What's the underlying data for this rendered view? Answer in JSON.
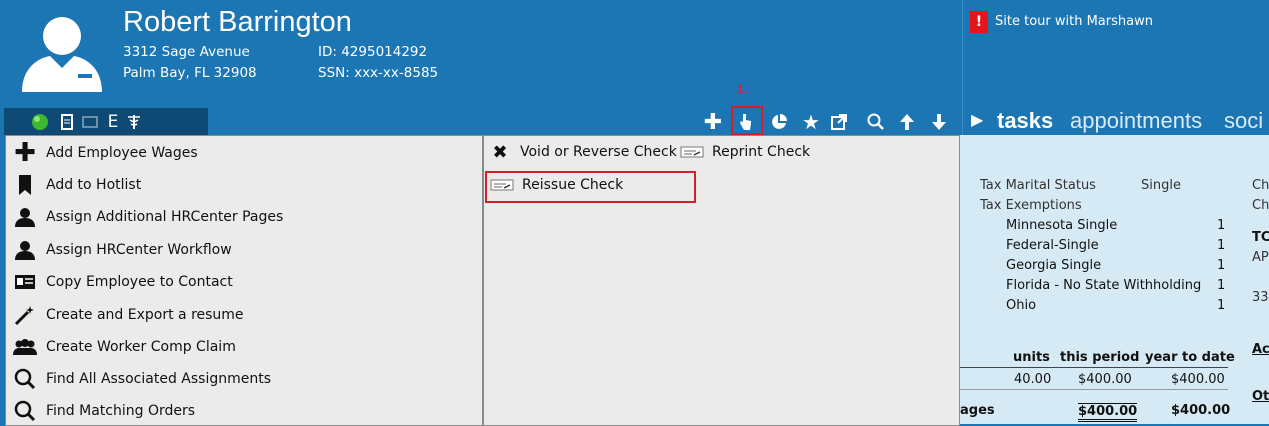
{
  "employee": {
    "name": "Robert Barrington",
    "address1": "3312 Sage Avenue",
    "address2": "Palm Bay, FL 32908",
    "id": "ID: 4295014292",
    "ssn": "SSN: xxx-xx-8585"
  },
  "status_icons": {
    "e_label": "E"
  },
  "toolbar": {
    "step_label": "1.",
    "icons": [
      "plus-icon",
      "pointer-hand-icon",
      "pie-chart-icon",
      "star-icon",
      "external-link-icon",
      "search-icon",
      "arrow-up-icon",
      "arrow-down-icon"
    ]
  },
  "tour": {
    "badge": "!",
    "text": "Site tour with Marshawn"
  },
  "tabs": {
    "arrow": "▶",
    "tasks": "tasks",
    "appointments": "appointments",
    "social": "soci"
  },
  "menu_left": [
    {
      "label": "Add Employee Wages",
      "icon": "plus-icon"
    },
    {
      "label": "Add to Hotlist",
      "icon": "bookmark-icon"
    },
    {
      "label": "Assign Additional HRCenter Pages",
      "icon": "person-icon"
    },
    {
      "label": "Assign HRCenter Workflow",
      "icon": "person-icon"
    },
    {
      "label": "Copy Employee to Contact",
      "icon": "contact-card-icon"
    },
    {
      "label": "Create and Export a resume",
      "icon": "magic-wand-icon"
    },
    {
      "label": "Create Worker Comp Claim",
      "icon": "group-icon"
    },
    {
      "label": "Find All Associated Assignments",
      "icon": "search-icon"
    },
    {
      "label": "Find Matching Orders",
      "icon": "search-icon"
    }
  ],
  "menu_right": {
    "void": "Void or Reverse Check",
    "reprint": "Reprint Check",
    "reissue": "Reissue Check"
  },
  "detail": {
    "tax_marital_label": "Tax Marital Status",
    "tax_marital_value": "Single",
    "tax_exemptions_label": "Tax Exemptions",
    "exemptions": [
      {
        "name": "Minnesota Single",
        "value": "1"
      },
      {
        "name": "Federal-Single",
        "value": "1"
      },
      {
        "name": "Georgia Single",
        "value": "1"
      },
      {
        "name": "Florida - No State Withholding",
        "value": "1"
      },
      {
        "name": "Ohio",
        "value": "1"
      }
    ],
    "right_col": [
      "Ch",
      "Ch",
      "TC",
      "AP",
      "33",
      "Ac",
      "Ot"
    ],
    "col_units": "units",
    "col_this_period": "this period",
    "col_ytd": "year to date",
    "row1_units": "40.00",
    "row1_period": "$400.00",
    "row1_ytd": "$400.00",
    "row2_label": "ages",
    "row2_period": "$400.00",
    "row2_ytd": "$400.00"
  },
  "colors": {
    "header_blue": "#1c76b4",
    "dark_bar": "#0f4a75",
    "highlight_red": "#d61e2a",
    "menu_bg": "#ebebeb",
    "detail_bg": "#d6eaf5"
  }
}
